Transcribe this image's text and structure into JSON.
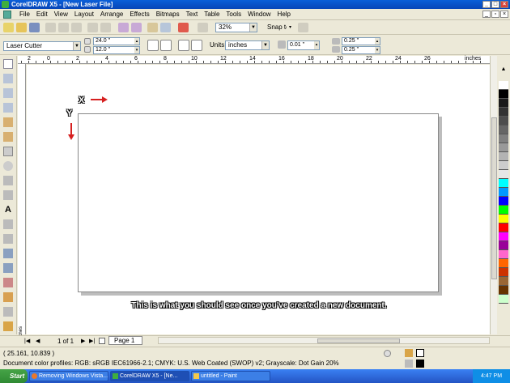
{
  "titlebar": {
    "title": "CorelDRAW X5 - [New Laser File]"
  },
  "menubar": {
    "items": [
      "File",
      "Edit",
      "View",
      "Layout",
      "Arrange",
      "Effects",
      "Bitmaps",
      "Text",
      "Table",
      "Tools",
      "Window",
      "Help"
    ]
  },
  "stdbar": {
    "zoom": "32%",
    "snap": "Snap to"
  },
  "propbar": {
    "preset": "Laser Cutter",
    "width": "24.0 \"",
    "height": "12.0 \"",
    "units_label": "Units:",
    "units": "inches",
    "nudge": "0.01 \"",
    "dup_x": "0.25 \"",
    "dup_y": "0.25 \""
  },
  "ruler": {
    "top_labels": [
      "2",
      "0",
      "2",
      "4",
      "6",
      "8",
      "10",
      "12",
      "14",
      "16",
      "18",
      "20",
      "22",
      "24",
      "26"
    ],
    "unit": "inches"
  },
  "canvas": {
    "x_label": "X",
    "y_label": "Y",
    "caption": "This is what you should see once you've created a new document."
  },
  "docnav": {
    "page_count": "1 of 1",
    "page_tab": "Page 1"
  },
  "status": {
    "coords": "( 25.161, 10.839 )",
    "profiles": "Document color profiles: RGB: sRGB IEC61966-2.1; CMYK: U.S. Web Coated (SWOP) v2; Grayscale: Dot Gain 20%"
  },
  "palette": {
    "colors": [
      "#ffffff",
      "#000000",
      "#1a1a1a",
      "#333333",
      "#4d4d4d",
      "#666666",
      "#808080",
      "#999999",
      "#b3b3b3",
      "#cccccc",
      "#e6e6e6",
      "#00ffff",
      "#0099ff",
      "#0000ff",
      "#00ff00",
      "#ffff00",
      "#ff0000",
      "#ff00ff",
      "#990099",
      "#ff66cc",
      "#ff6600",
      "#cc3300",
      "#996633",
      "#663300",
      "#ccffcc"
    ]
  },
  "taskbar": {
    "start": "Start",
    "tasks": [
      "Removing Windows Vista...",
      "CorelDRAW X5 - [Ne...",
      "untitled - Paint"
    ],
    "clock": "4:47 PM"
  }
}
